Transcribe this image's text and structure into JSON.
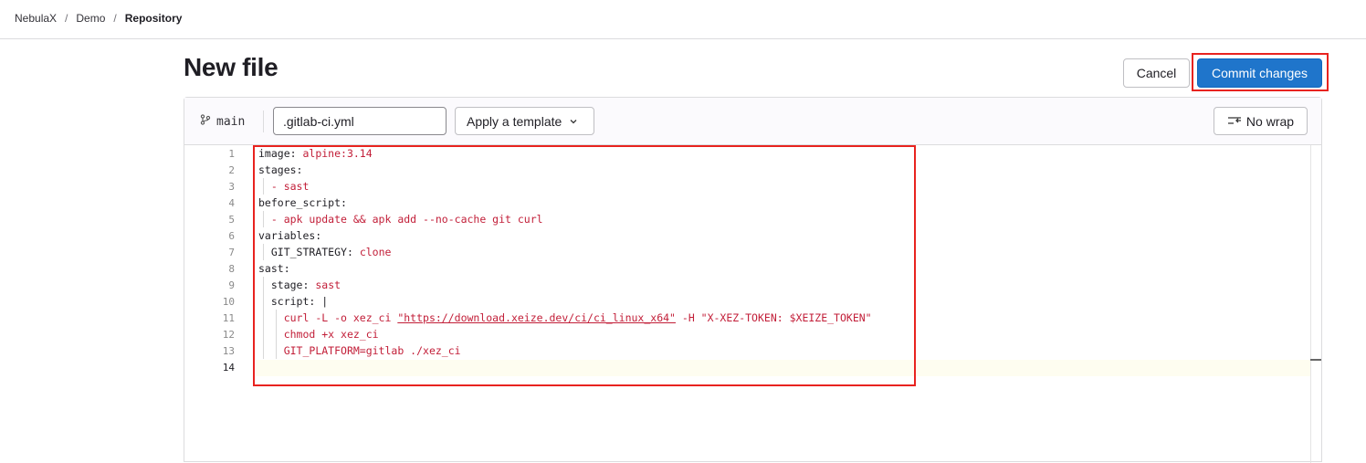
{
  "breadcrumb": {
    "items": [
      "NebulaX",
      "Demo"
    ],
    "current": "Repository",
    "separator": "/"
  },
  "page": {
    "title": "New file"
  },
  "actions": {
    "cancel_label": "Cancel",
    "commit_label": "Commit changes"
  },
  "editor": {
    "branch": "main",
    "branch_icon": "branch-icon",
    "filename": ".gitlab-ci.yml",
    "template_label": "Apply a template",
    "nowrap_label": "No wrap",
    "line_numbers": [
      "1",
      "2",
      "3",
      "4",
      "5",
      "6",
      "7",
      "8",
      "9",
      "10",
      "11",
      "12",
      "13",
      "14"
    ],
    "active_line": "14",
    "code": {
      "l1_key": "image:",
      "l1_val": "alpine:3.14",
      "l2_key": "stages:",
      "l3_val": "- sast",
      "l4_key": "before_script:",
      "l5_val": "- apk update && apk add --no-cache git curl",
      "l6_key": "variables:",
      "l7_key": "GIT_STRATEGY:",
      "l7_val": "clone",
      "l8_key": "sast:",
      "l9_key": "stage:",
      "l9_val": "sast",
      "l10_key": "script:",
      "l10_val": "|",
      "l11_a": "curl -L -o xez_ci ",
      "l11_link": "\"https://download.xeize.dev/ci/ci_linux_x64\"",
      "l11_b": " -H \"X-XEZ-TOKEN: $XEIZE_TOKEN\"",
      "l12_val": "chmod +x xez_ci",
      "l13_val": "GIT_PLATFORM=gitlab ./xez_ci"
    }
  },
  "colors": {
    "primary": "#1f75cb",
    "highlight": "#e8231f",
    "code_value": "#c21e38"
  }
}
